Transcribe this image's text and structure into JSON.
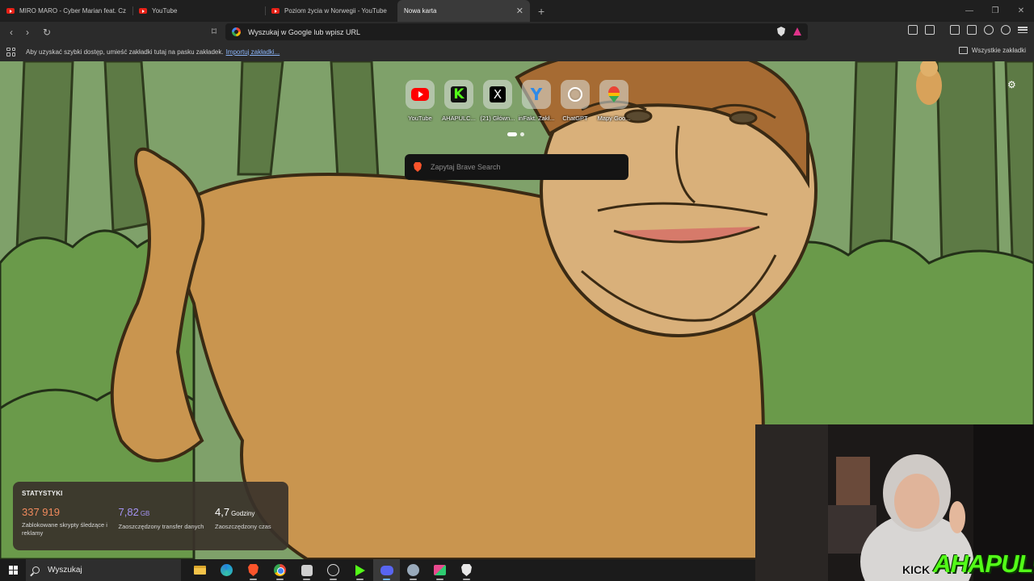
{
  "browser": {
    "tabs": [
      {
        "label": "MIRO MARO - Cyber Marian feat. Cz",
        "icon": "youtube-icon",
        "active": false
      },
      {
        "label": "YouTube",
        "icon": "youtube-icon",
        "active": false
      },
      {
        "label": "Poziom życia w Norwegii - YouTube",
        "icon": "youtube-icon",
        "active": false
      },
      {
        "label": "Nowa karta",
        "icon": "none",
        "active": true
      }
    ],
    "address_placeholder": "Wyszukaj w Google lub wpisz URL"
  },
  "bookmarks_bar": {
    "hint": "Aby uzyskać szybki dostęp, umieść zakładki tutaj na pasku zakładek.",
    "import_link": "Importuj zakładki...",
    "all_bookmarks": "Wszystkie zakładki"
  },
  "new_tab": {
    "top_sites": [
      {
        "label": "YouTube",
        "icon": "youtube-icon"
      },
      {
        "label": "AHAPULC...",
        "icon": "kick-icon"
      },
      {
        "label": "(21) Główn...",
        "icon": "x-icon"
      },
      {
        "label": "inFakt. Zakł...",
        "icon": "infakt-icon"
      },
      {
        "label": "ChatGPT",
        "icon": "chatgpt-icon"
      },
      {
        "label": "Mapy Goo...",
        "icon": "google-maps-icon"
      }
    ],
    "search_placeholder": "Zapytaj Brave Search",
    "stats": {
      "title": "STATYSTYKI",
      "items": [
        {
          "value": "337 919",
          "unit": "",
          "desc": "Zablokowane skrypty śledzące i reklamy",
          "color": "#f08a5d"
        },
        {
          "value": "7,82",
          "unit": "GB",
          "desc": "Zaoszczędzony transfer danych",
          "color": "#a493f2"
        },
        {
          "value": "4,7",
          "unit": "Godziny",
          "desc": "Zaoszczędzony czas",
          "color": "#ffffff"
        }
      ]
    }
  },
  "overlay": {
    "kick_small": "KICK",
    "kick_big": "AHAPULCO"
  },
  "taskbar": {
    "search_label": "Wyszukaj",
    "apps": [
      {
        "name": "file-explorer-icon",
        "running": false,
        "active": false
      },
      {
        "name": "edge-icon",
        "running": false,
        "active": false
      },
      {
        "name": "brave-icon",
        "running": true,
        "active": false
      },
      {
        "name": "chrome-icon",
        "running": true,
        "active": false
      },
      {
        "name": "app-icon",
        "running": true,
        "active": false
      },
      {
        "name": "obs-icon",
        "running": true,
        "active": false
      },
      {
        "name": "kick-streamer-icon",
        "running": true,
        "active": false
      },
      {
        "name": "discord-icon",
        "running": true,
        "active": true
      },
      {
        "name": "steam-icon",
        "running": true,
        "active": false
      },
      {
        "name": "capture-icon",
        "running": true,
        "active": false
      },
      {
        "name": "brave-white-icon",
        "running": true,
        "active": false
      }
    ]
  }
}
